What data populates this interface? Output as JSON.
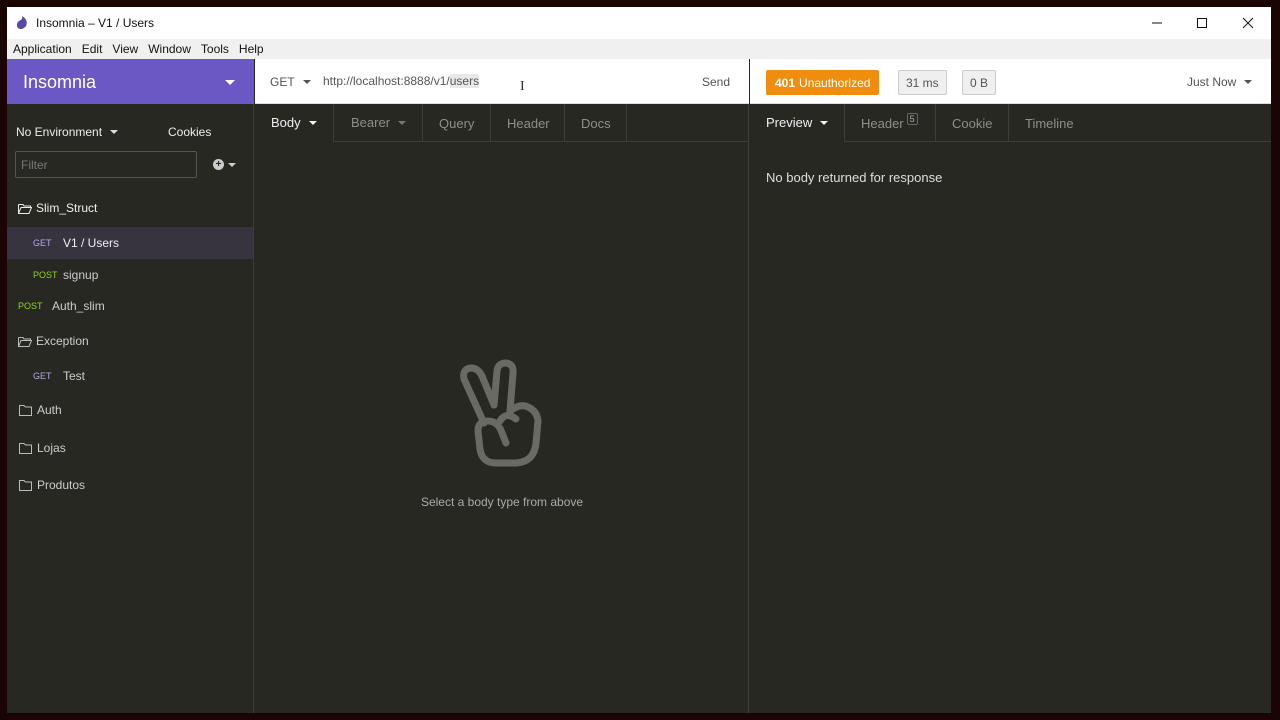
{
  "window": {
    "title": "Insomnia – V1 / Users",
    "accent_color": "#6b58c4"
  },
  "menu": [
    "Application",
    "Edit",
    "View",
    "Window",
    "Tools",
    "Help"
  ],
  "sidebar": {
    "workspace": "Insomnia",
    "environment": "No Environment",
    "cookies": "Cookies",
    "filter_placeholder": "Filter",
    "items": [
      {
        "type": "folder",
        "label": "Slim_Struct",
        "open": true
      },
      {
        "type": "request",
        "method": "GET",
        "label": "V1 / Users",
        "active": true
      },
      {
        "type": "request",
        "method": "POST",
        "label": "signup"
      },
      {
        "type": "request",
        "method": "POST",
        "label": "Auth_slim"
      },
      {
        "type": "folder",
        "label": "Exception",
        "open": true
      },
      {
        "type": "request",
        "method": "GET",
        "label": "Test"
      },
      {
        "type": "folder",
        "label": "Auth",
        "open": false
      },
      {
        "type": "folder",
        "label": "Lojas",
        "open": false
      },
      {
        "type": "folder",
        "label": "Produtos",
        "open": false
      }
    ]
  },
  "request": {
    "method": "GET",
    "url_prefix": "http://localhost:8888/v1/",
    "url_selected": "users",
    "send_label": "Send",
    "tabs": [
      "Body",
      "Bearer",
      "Query",
      "Header",
      "Docs"
    ],
    "empty_text": "Select a body type from above"
  },
  "response": {
    "status_code": "401",
    "status_text": "Unauthorized",
    "status_color": "#f08c0e",
    "time": "31 ms",
    "size": "0 B",
    "when": "Just Now",
    "tabs": [
      "Preview",
      "Header",
      "Cookie",
      "Timeline"
    ],
    "header_count": "5",
    "empty_text": "No body returned for response"
  }
}
